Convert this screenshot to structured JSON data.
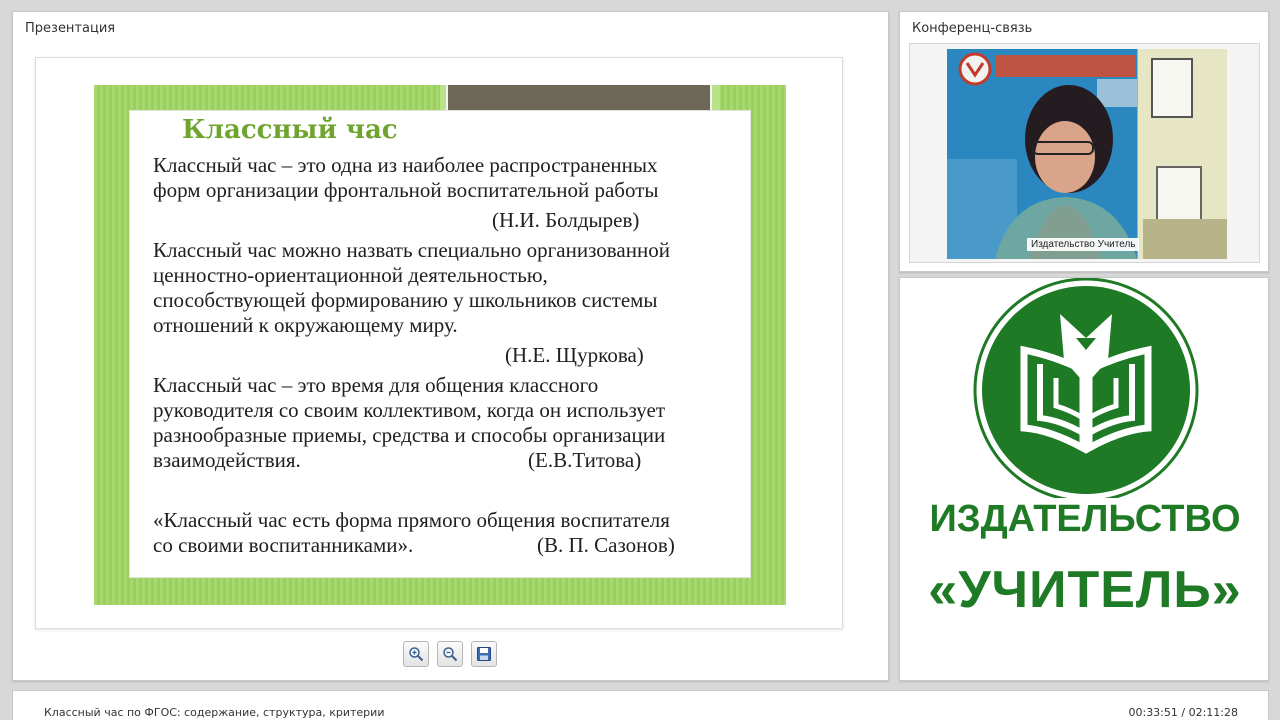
{
  "presentation": {
    "panel_title": "Презентация",
    "slide": {
      "title": "Классный час",
      "paragraphs": [
        {
          "lines": [
            "Классный час – это одна из наиболее распространенных",
            "форм организации фронтальной воспитательной работы"
          ],
          "author": "(Н.И. Болдырев)"
        },
        {
          "lines": [
            "Классный час можно назвать специально организованной",
            "ценностно-ориентационной деятельностью,",
            "способствующей формированию у школьников системы",
            "отношений к окружающему миру."
          ],
          "author": "(Н.Е. Щуркова)"
        },
        {
          "lines": [
            "Классный час – это время для общения классного",
            "руководителя со своим коллективом, когда он использует",
            "разнообразные приемы, средства и способы организации",
            "взаимодействия."
          ],
          "author": "(Е.В.Титова)"
        },
        {
          "lines": [
            "«Классный час есть форма прямого общения воспитателя",
            "со своими воспитанниками»."
          ],
          "author": "(В. П. Сазонов)"
        }
      ]
    },
    "toolbar": {
      "zoom_in_icon": "zoom-in-icon",
      "zoom_out_icon": "zoom-out-icon",
      "save_icon": "save-icon"
    }
  },
  "conference": {
    "panel_title": "Конференц-связь",
    "participant_name": "Издательство Учитель"
  },
  "logo": {
    "line1": "ИЗДАТЕЛЬСТВО",
    "line2": "«УЧИТЕЛЬ»",
    "color": "#1f7a25"
  },
  "footer": {
    "session_title": "Классный час по ФГОС: содержание, структура, критерии",
    "time": "00:33:51 / 02:11:28"
  }
}
